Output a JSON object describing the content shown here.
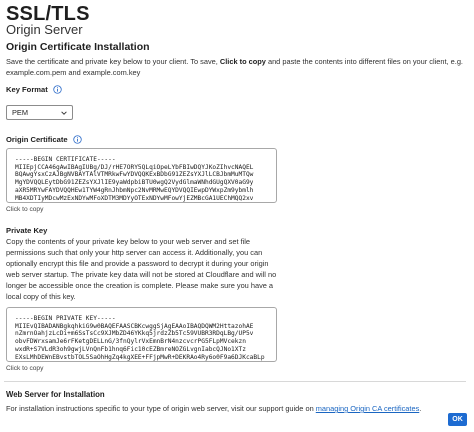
{
  "header": {
    "title": "SSL/TLS",
    "subtitle": "Origin Server"
  },
  "install": {
    "title": "Origin Certificate Installation",
    "desc_before": "Save the certificate and private key below to your client. To save, ",
    "desc_bold": "Click to copy",
    "desc_after": " and paste the contents into different files on your client, e.g. example.com.pem and example.com.key"
  },
  "key_format": {
    "label": "Key Format",
    "selected": "PEM"
  },
  "certificate": {
    "label": "Origin Certificate",
    "lines": [
      "-----BEGIN CERTIFICATE-----",
      "MIIEpjCCA46gAwIBAgIUBg/DJ/rHE7ORY5QLqiOpeLYbFBIwDQYJKoZIhvcNAQEL",
      "BQAwgYsxCzAJBgNVBAYTAlVTMRkwFwYDVQQKExBDbG91ZEZsYXJlLCBJbmMuMTQw",
      "MgYDVQQLEytDbG91ZEZsYXJlIE9yaWdpbiBTU0wgQ2VydGlmaWNhdGUgQXV0aG9y",
      "aXR5MRYwFAYDVQQHEw1TYW4gRnJhbmNpc2NvMRMwEQYDVQQIEwpDYWxpZm9ybmlh",
      "MB4XDTIyMDcwMzExNDYwMFoXDTM3MDYyOTExNDYwMFowYjEZMBcGA1UEChMQQ2xv"
    ],
    "copy_label": "Click to copy"
  },
  "private_key": {
    "label": "Private Key",
    "desc": "Copy the contents of your private key below to your web server and set file permissions such that only your http server can access it. Additionally, you can optionally encrypt this file and provide a password to decrypt it during your origin web server startup. The private key data will not be stored at Cloudflare and will no longer be accessible once the creation is complete. Please make sure you have a local copy of this key.",
    "lines": [
      "-----BEGIN PRIVATE KEY-----",
      "MIIEvQIBADANBgkqhkiG9w0BAQEFAASCBKcwggSjAgEAAoIBAQDQWM2HttazohAE",
      "nZmrnOahjzLcDi+m6SsTsCc9XJMbZD46YKkq5jrdzZb5Tc59VUBR3RDqLBg/UP5v",
      "obvFDWrxsamJe6rFKetgDELLnG/3fnQylrVxEmnBrN4nzcvcrPG5FLpMVcekzn",
      "wxdR+S7VLdR3oh9gwjLVnQnFb1hnq6Fic10cEZBmreNOZGLvgnIabcQJNo1XTz",
      "EXsLMhDEWnEBvstbTOL5SaOhHgZq4kgXEE+FFjpMwR+DEKRAo4Ry6o0F9a6DJKcaBLp"
    ],
    "copy_label": "Click to copy"
  },
  "web_server": {
    "title": "Web Server for Installation",
    "desc_before": "For installation instructions specific to your type of origin web server, visit our support guide on ",
    "link_text": "managing Origin CA certificates",
    "desc_after": "."
  },
  "actions": {
    "ok_label": "OK"
  },
  "colors": {
    "accent": "#1d6bd1",
    "link": "#1a66c2"
  }
}
